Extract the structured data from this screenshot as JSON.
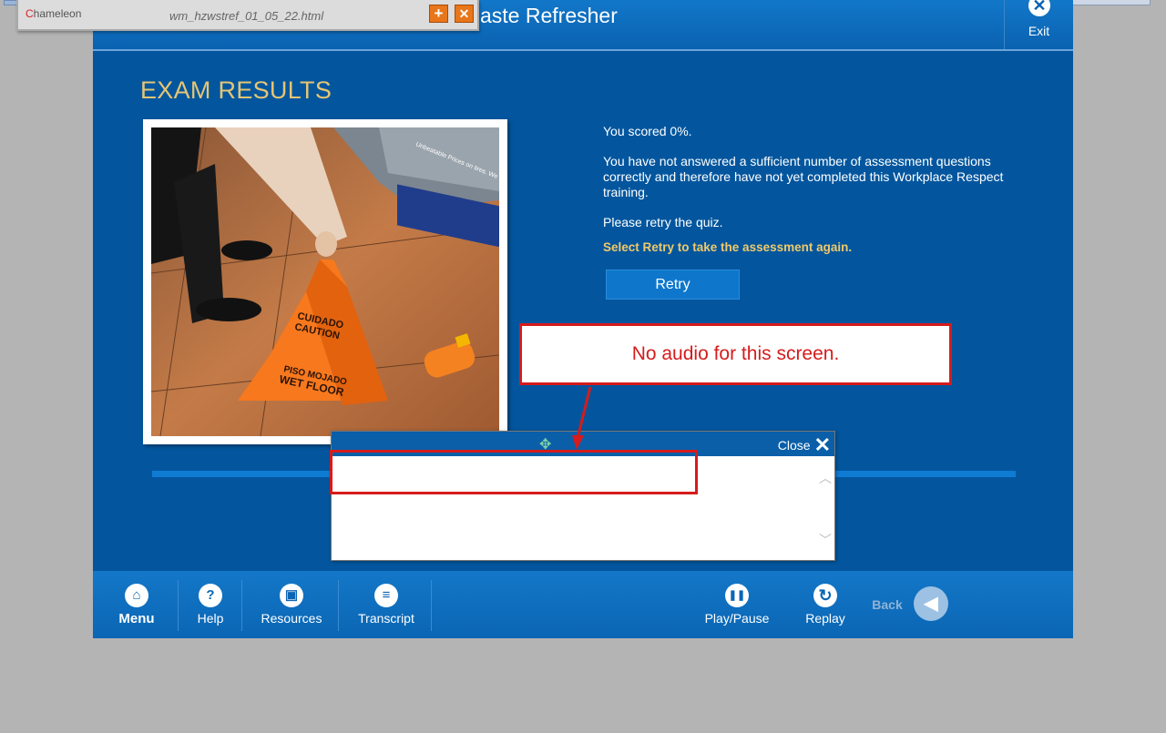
{
  "app": {
    "course_title": "aste Refresher",
    "exit_label": "Exit",
    "heading": "EXAM RESULTS"
  },
  "browser_window": {
    "logo_text": "hameleon",
    "logo_initial": "C",
    "filename": "wm_hzwstref_01_05_22.html",
    "add_icon": "+",
    "close_icon": "✕"
  },
  "results": {
    "score_text": "You scored 0%.",
    "message": "You have not answered a sufficient number of assessment questions correctly and therefore have not yet completed this Workplace Respect training.",
    "retry_prompt": "Please retry the quiz.",
    "instruction": "Select Retry to take the assessment again.",
    "retry_label": "Retry"
  },
  "photo": {
    "sign_line1": "CUIDADO",
    "sign_line2": "CAUTION",
    "sign_line3": "PISO MOJADO",
    "sign_line4": "WET FLOOR",
    "shelf_text": "Unbeatable Prices on tires. We Guar"
  },
  "callout": {
    "text": "No audio for this screen."
  },
  "transcript_dialog": {
    "close_label": "Close",
    "close_icon": "✕",
    "move_icon": "✥"
  },
  "nav": {
    "menu": "Menu",
    "help": "Help",
    "resources": "Resources",
    "transcript": "Transcript",
    "play_pause": "Play/Pause",
    "replay": "Replay",
    "back": "Back",
    "icons": {
      "menu": "⌂",
      "help": "?",
      "resources": "▣",
      "transcript": "≡",
      "play_pause": "❚❚",
      "replay": "↻",
      "back": "◀"
    }
  },
  "colors": {
    "content_bg": "#03569e",
    "heading": "#e5c573",
    "highlight": "#f0c96a",
    "callout_red": "#d61b1b"
  }
}
